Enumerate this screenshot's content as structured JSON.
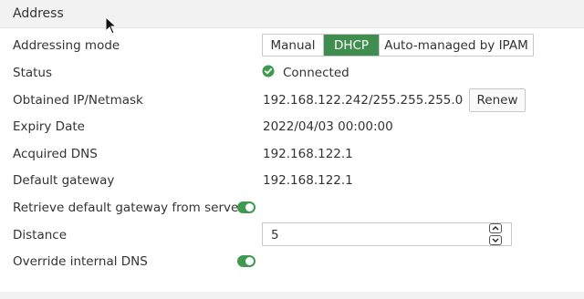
{
  "section": {
    "title": "Address"
  },
  "fields": {
    "addressing_mode": {
      "label": "Addressing mode",
      "options": [
        "Manual",
        "DHCP",
        "Auto-managed by IPAM"
      ],
      "selected": "DHCP"
    },
    "status": {
      "label": "Status",
      "value": "Connected",
      "icon": "check-circle-icon"
    },
    "obtained_ip": {
      "label": "Obtained IP/Netmask",
      "value": "192.168.122.242/255.255.255.0",
      "button": "Renew"
    },
    "expiry_date": {
      "label": "Expiry Date",
      "value": "2022/04/03 00:00:00"
    },
    "acquired_dns": {
      "label": "Acquired DNS",
      "value": "192.168.122.1"
    },
    "default_gateway": {
      "label": "Default gateway",
      "value": "192.168.122.1"
    },
    "retrieve_gateway": {
      "label": "Retrieve default gateway from server",
      "enabled": true
    },
    "distance": {
      "label": "Distance",
      "value": "5"
    },
    "override_dns": {
      "label": "Override internal DNS",
      "enabled": true
    }
  },
  "colors": {
    "accent": "#3f8e4f",
    "toggle_on": "#3f9a4f",
    "header_bg": "#f2f2f2",
    "text": "#333333"
  }
}
